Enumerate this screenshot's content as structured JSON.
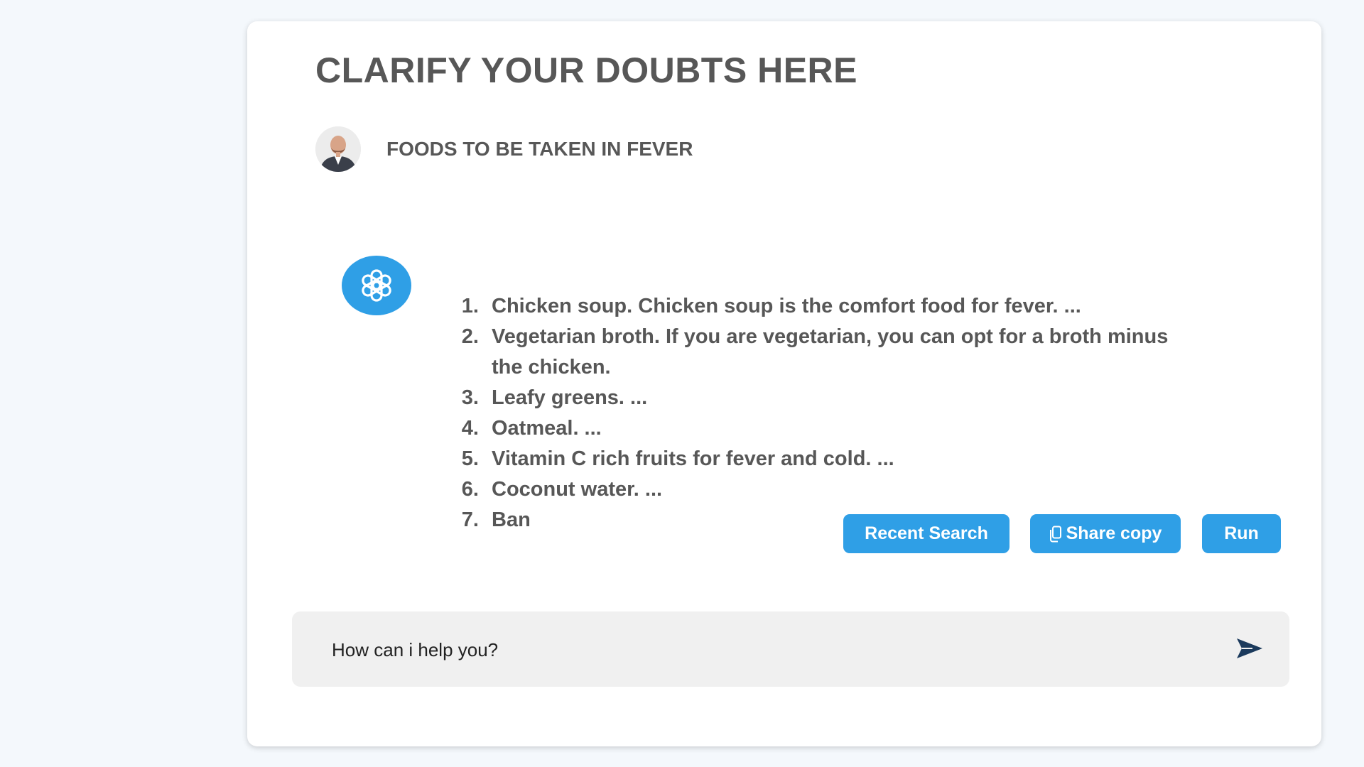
{
  "header": {
    "title": "CLARIFY YOUR DOUBTS HERE"
  },
  "question": {
    "avatar_icon": "user-photo-avatar",
    "text": "FOODS TO BE TAKEN IN FEVER"
  },
  "answer": {
    "bot_icon": "openai-logo-icon",
    "items": [
      "Chicken soup. Chicken soup is the comfort food for fever. ...",
      "Vegetarian broth. If you are vegetarian, you can opt for a broth minus the chicken.",
      "Leafy greens. ...",
      "Oatmeal. ...",
      "Vitamin C rich fruits for fever and cold. ...",
      "Coconut water. ...",
      "Ban"
    ]
  },
  "actions": {
    "recent_search": "Recent Search",
    "share_copy": "Share copy",
    "share_icon": "copy-icon",
    "run": "Run"
  },
  "chat": {
    "placeholder": "How can i help you?",
    "send_icon": "send-icon"
  },
  "colors": {
    "accent": "#2f9fe6",
    "text": "#575757",
    "background": "#f4f8fc",
    "input_bg": "#f0f0f0",
    "send_icon": "#1b3a5c"
  }
}
